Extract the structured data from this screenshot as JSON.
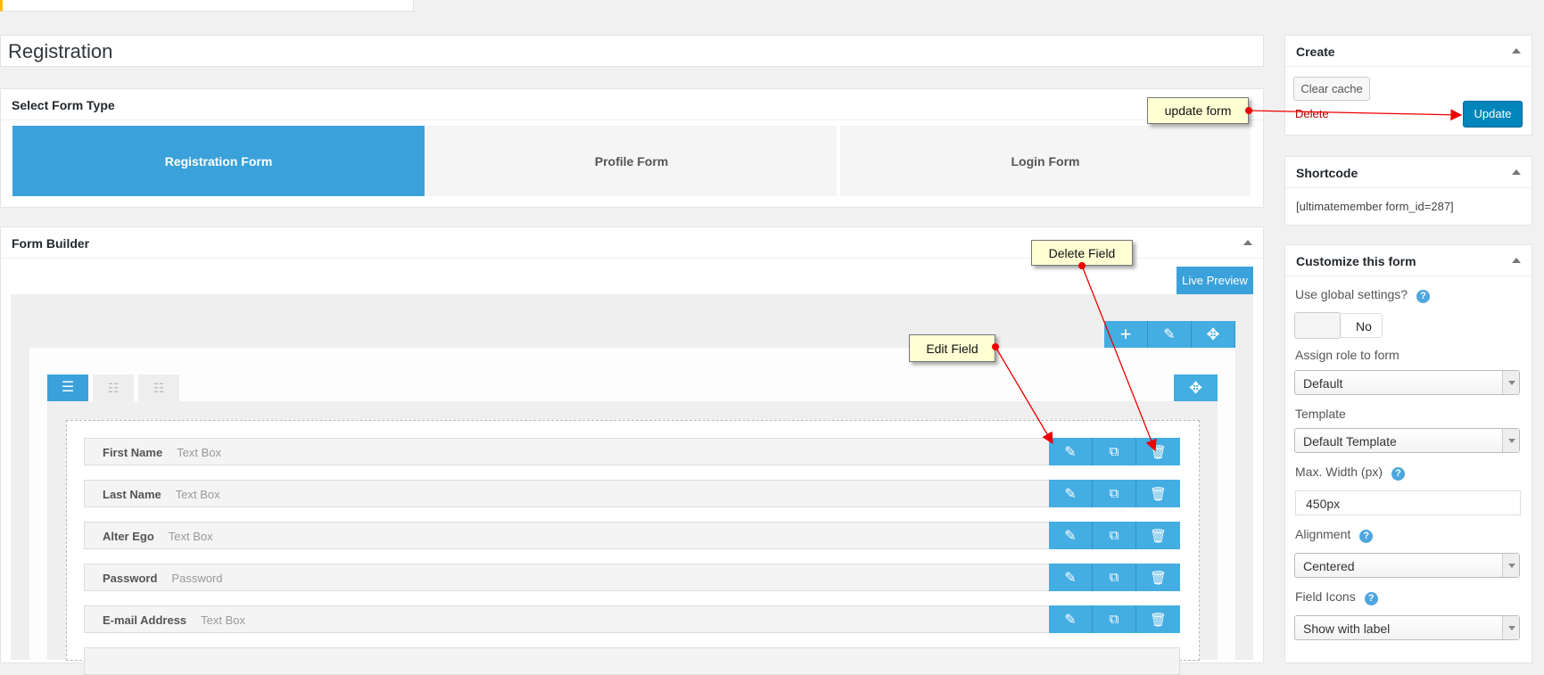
{
  "title": "Registration",
  "form_type": {
    "heading": "Select Form Type",
    "tabs": [
      {
        "label": "Registration Form",
        "active": true
      },
      {
        "label": "Profile Form"
      },
      {
        "label": "Login Form"
      }
    ]
  },
  "builder": {
    "heading": "Form Builder",
    "live_preview": "Live Preview",
    "fields": [
      {
        "label": "First Name",
        "type": "Text Box"
      },
      {
        "label": "Last Name",
        "type": "Text Box"
      },
      {
        "label": "Alter Ego",
        "type": "Text Box"
      },
      {
        "label": "Password",
        "type": "Password"
      },
      {
        "label": "E-mail Address",
        "type": "Text Box"
      }
    ]
  },
  "sidebar": {
    "create": {
      "heading": "Create",
      "clear_cache": "Clear cache",
      "delete": "Delete",
      "update": "Update"
    },
    "shortcode": {
      "heading": "Shortcode",
      "value": "[ultimatemember form_id=287]"
    },
    "customize": {
      "heading": "Customize this form",
      "use_global": "Use global settings?",
      "toggle_value": "No",
      "assign_role": "Assign role to form",
      "role_value": "Default",
      "template": "Template",
      "template_value": "Default Template",
      "max_width": "Max. Width (px)",
      "max_width_value": "450px",
      "alignment": "Alignment",
      "alignment_value": "Centered",
      "field_icons": "Field Icons",
      "field_icons_value": "Show with label",
      "help": "?"
    }
  },
  "annotations": {
    "update": "update form",
    "delete": "Delete Field",
    "edit": "Edit Field"
  },
  "colors": {
    "accent": "#3ba1da",
    "primary": "#0085ba",
    "annotation": "#e00000"
  }
}
